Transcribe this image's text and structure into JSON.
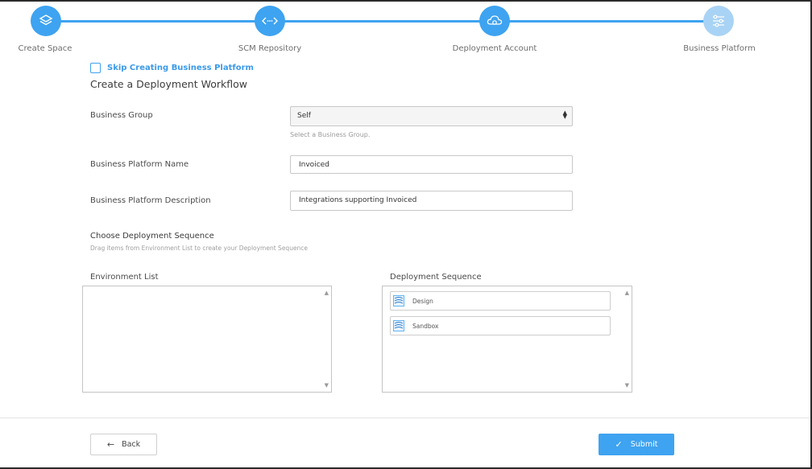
{
  "stepper": {
    "steps": [
      {
        "label": "Create Space",
        "icon": "layers-icon",
        "state": "complete"
      },
      {
        "label": "SCM Repository",
        "icon": "code-arrows-icon",
        "state": "complete"
      },
      {
        "label": "Deployment Account",
        "icon": "cloud-icon",
        "state": "complete"
      },
      {
        "label": "Business Platform",
        "icon": "sliders-icon",
        "state": "active"
      }
    ],
    "accent_color": "#3ea3f0",
    "inactive_color": "#a9d3f5"
  },
  "skip": {
    "label": "Skip Creating Business Platform",
    "checked": false
  },
  "form": {
    "title": "Create a Deployment Workflow",
    "business_group": {
      "label": "Business Group",
      "value": "Self",
      "hint": "Select a Business Group."
    },
    "platform_name": {
      "label": "Business Platform Name",
      "value": "Invoiced"
    },
    "platform_description": {
      "label": "Business Platform Description",
      "value": "Integrations supporting Invoiced"
    }
  },
  "sequence": {
    "title": "Choose Deployment Sequence",
    "hint": "Drag items from Environment List to create your Deployment Sequence",
    "environment_list": {
      "label": "Environment List",
      "items": []
    },
    "deployment_sequence": {
      "label": "Deployment Sequence",
      "items": [
        {
          "label": "Design",
          "icon": "environment-icon"
        },
        {
          "label": "Sandbox",
          "icon": "environment-icon"
        }
      ]
    }
  },
  "footer": {
    "back_label": "Back",
    "submit_label": "Submit"
  }
}
